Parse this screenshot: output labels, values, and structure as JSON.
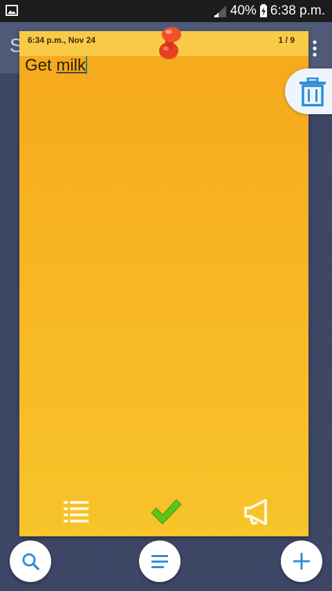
{
  "status_bar": {
    "battery": "40%",
    "time": "6:38 p.m.",
    "icons": [
      "image-notification-icon",
      "signal-icon",
      "battery-charging-icon"
    ]
  },
  "app_bar": {
    "title_partial": "S",
    "menu_icon": "more-vert-icon"
  },
  "note": {
    "timestamp": "6:34 p.m., Nov 24",
    "page_indicator": "1 / 9",
    "text_plain": "Get ",
    "text_underlined": "milk",
    "color": "#f7b523",
    "pin_icon": "push-pin-icon",
    "toolbar": [
      "checklist-icon",
      "check-icon",
      "megaphone-icon"
    ]
  },
  "side_actions": {
    "delete_icon": "trash-icon"
  },
  "bottom_bar": {
    "buttons": [
      "search-icon",
      "menu-lines-icon",
      "plus-icon"
    ]
  },
  "colors": {
    "accent": "#2e8ed6",
    "check": "#5cc51a"
  }
}
